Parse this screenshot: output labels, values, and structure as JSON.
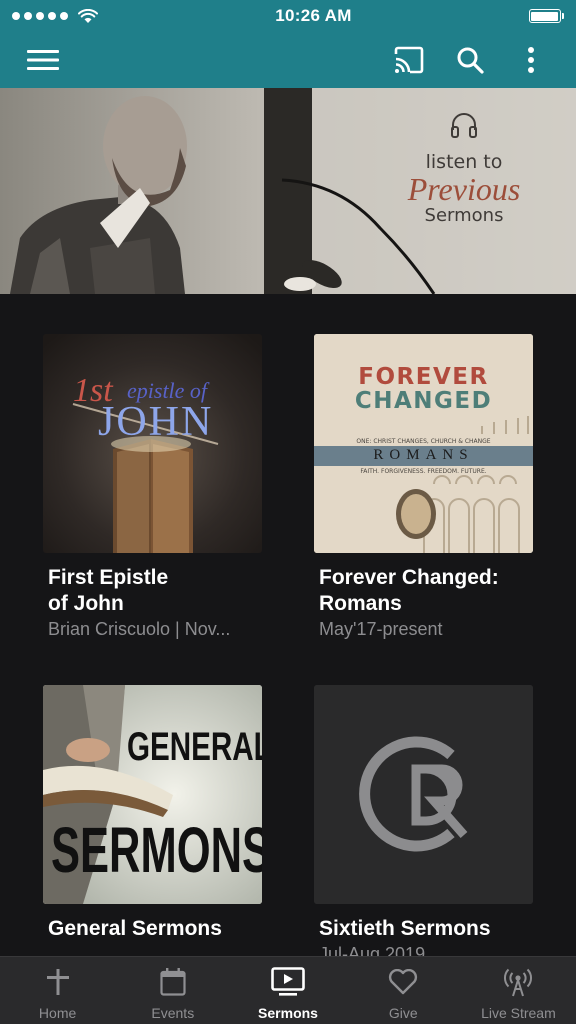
{
  "status_bar": {
    "time": "10:26 AM",
    "signal_icon": "signal-dots-icon",
    "wifi_icon": "wifi-icon",
    "battery_icon": "battery-full-icon"
  },
  "app_bar": {
    "menu_icon": "hamburger-menu-icon",
    "cast_icon": "cast-icon",
    "search_icon": "search-icon",
    "more_icon": "more-vertical-icon",
    "background_color": "#1f7f8a"
  },
  "hero": {
    "line1": "listen to",
    "line2": "Previous",
    "line3": "Sermons",
    "headphones_icon": "headphones-icon"
  },
  "series": [
    {
      "title_line1": "First Epistle",
      "title_line2": "of John",
      "subtitle": "Brian Criscuolo | Nov...",
      "art": {
        "script": "1st",
        "script2": "epistle of",
        "word": "JOHN"
      }
    },
    {
      "title_line1": "Forever Changed:",
      "title_line2": "Romans",
      "subtitle": "May'17-present",
      "art": {
        "line1": "FOREVER",
        "line2": "CHANGED",
        "top_small": "ONE: CHRIST CHANGES, CHURCH & CHANGE",
        "band": "ROMANS",
        "bottom_small": "FAITH. FORGIVENESS. FREEDOM. FUTURE."
      }
    },
    {
      "title_line1": "General Sermons",
      "title_line2": "",
      "subtitle": "",
      "art": {
        "line1": "GENERAL",
        "line2": "SERMONS"
      }
    },
    {
      "title_line1": "Sixtieth Sermons",
      "title_line2": "",
      "subtitle": "Jul-Aug 2019",
      "art": {
        "logo_icon": "cr-logo-icon"
      }
    }
  ],
  "tabs": [
    {
      "label": "Home",
      "icon": "plus-icon",
      "active": false
    },
    {
      "label": "Events",
      "icon": "calendar-icon",
      "active": false
    },
    {
      "label": "Sermons",
      "icon": "video-play-icon",
      "active": true
    },
    {
      "label": "Give",
      "icon": "heart-icon",
      "active": false
    },
    {
      "label": "Live Stream",
      "icon": "broadcast-icon",
      "active": false
    }
  ]
}
